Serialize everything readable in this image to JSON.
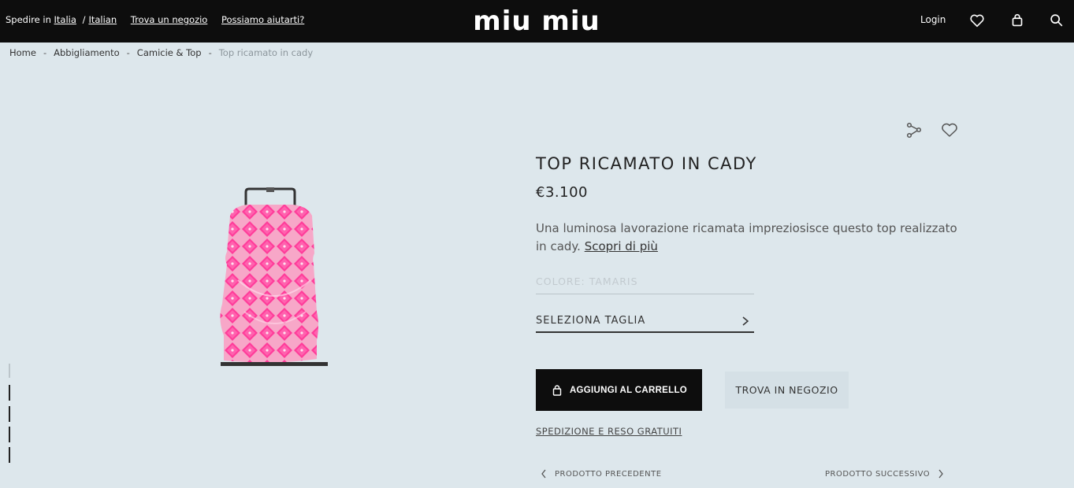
{
  "header": {
    "ship_label": "Spedire in",
    "country": "Italia",
    "separator": "/",
    "language": "Italian",
    "find_store": "Trova un negozio",
    "help": "Possiamo aiutarti?",
    "logo": "miu miu",
    "login": "Login",
    "icons": [
      "heart-icon",
      "bag-icon",
      "search-icon"
    ]
  },
  "breadcrumb": {
    "items": [
      "Home",
      "Abbigliamento",
      "Camicie & Top"
    ],
    "current": "Top ricamato in cady",
    "separator": "-"
  },
  "product": {
    "title": "TOP RICAMATO IN CADY",
    "price": "€3.100",
    "description": "Una luminosa lavorazione ricamata impreziosisce questo top realizzato in cady.",
    "more_link": "Scopri di più",
    "color_label": "COLORE: TAMARIS",
    "size_label": "SELEZIONA TAGLIA",
    "add_to_cart": "AGGIUNGI AL CARRELLO",
    "find_in_store": "TROVA IN NEGOZIO",
    "shipping": "SPEDIZIONE E RESO GRATUITI",
    "prev": "PRODOTTO PRECEDENTE",
    "next": "PRODOTTO SUCCESSIVO"
  },
  "colors": {
    "background": "#dde7ec",
    "header": "#0d0d0d",
    "product_pink": "#ff3c9a"
  }
}
